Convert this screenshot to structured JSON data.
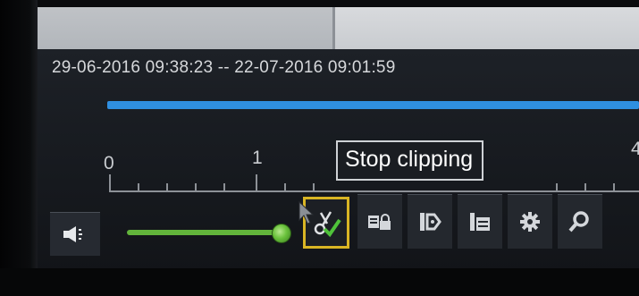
{
  "player": {
    "time_range": "29-06-2016 09:38:23 -- 22-07-2016 09:01:59",
    "progress_color": "#2f8fe0"
  },
  "timeline": {
    "tick_labels": [
      "0",
      "1",
      "4"
    ]
  },
  "volume": {
    "level": 0.95,
    "accent": "#62b43b"
  },
  "toolbar": {
    "tooltip": "Stop clipping",
    "buttons": [
      {
        "icon": "clip-check-icon",
        "active": true
      },
      {
        "icon": "lock-file-icon"
      },
      {
        "icon": "tag-icon"
      },
      {
        "icon": "file-list-icon"
      },
      {
        "icon": "gear-icon"
      },
      {
        "icon": "zoom-icon"
      }
    ],
    "highlight_color": "#d9b524"
  }
}
